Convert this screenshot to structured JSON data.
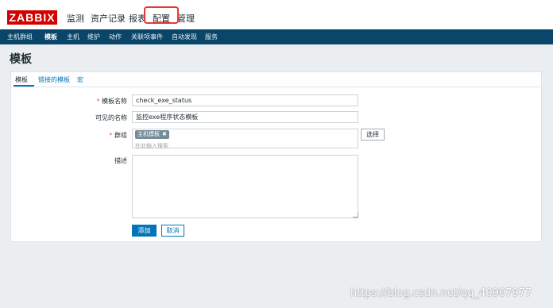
{
  "app": {
    "logo_text": "ZABBIX"
  },
  "main_nav": [
    "监测",
    "资产记录",
    "报表",
    "配置",
    "管理"
  ],
  "sub_nav": [
    "主机群组",
    "模板",
    "主机",
    "维护",
    "动作",
    "关联项事件",
    "自动发现",
    "服务"
  ],
  "page": {
    "title": "模板"
  },
  "tabs": [
    "模板",
    "链接的模板",
    "宏"
  ],
  "form": {
    "template_name_label": "模板名称",
    "template_name_value": "check_exe_status",
    "visible_name_label": "可见的名称",
    "visible_name_value": "监控exe程序状态模板",
    "groups_label": "群组",
    "group_chip": "主机模板",
    "group_chip_remove": "✖",
    "groups_placeholder": "在此输入搜索",
    "select_button": "选择",
    "description_label": "描述",
    "description_value": "",
    "add_button": "添加",
    "cancel_button": "取消"
  },
  "watermark": "https://blog.csdn.net/qq_40907977",
  "colors": {
    "logo_bg": "#d40000",
    "subnav_bg": "#0a466a",
    "accent": "#0275b8",
    "highlight_box": "#e53935",
    "page_bg": "#ebeef0"
  }
}
